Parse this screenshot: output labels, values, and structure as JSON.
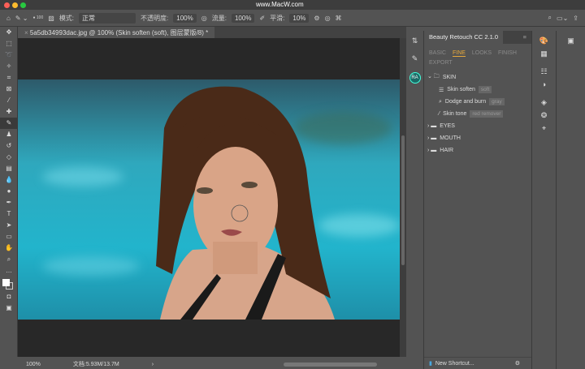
{
  "window": {
    "watermark": "www.MacW.com"
  },
  "options_bar": {
    "mode_label": "模式:",
    "mode_value": "正常",
    "opacity_label": "不透明度:",
    "opacity_value": "100%",
    "flow_label": "流量:",
    "flow_value": "100%",
    "smooth_label": "平滑:",
    "smooth_value": "10%",
    "brush_size": "100"
  },
  "document_tab": {
    "title": "5a5db34993dac.jpg @ 100% (Skin soften (soft), 图层蒙版/8) *"
  },
  "status": {
    "zoom": "100%",
    "doc_size": "文档:5.93M/13.7M"
  },
  "panel": {
    "title": "Beauty Retouch CC 2.1.0",
    "tabs": [
      "BASIC",
      "FINE",
      "LOOKS",
      "FINISH",
      "EXPORT"
    ],
    "active_tab": "FINE",
    "badge": "RA",
    "tree": {
      "skin": "SKIN",
      "items": [
        {
          "label": "Skin soften",
          "tag": "soft"
        },
        {
          "label": "Dodge and burn",
          "tag": "gray"
        },
        {
          "label": "Skin tone",
          "tag": "red remover"
        }
      ],
      "folders": [
        "EYES",
        "MOUTH",
        "HAIR"
      ]
    },
    "new_shortcut": "New Shortcut..."
  },
  "colors": {
    "accent": "#e8a93b",
    "bg": "#535353"
  }
}
